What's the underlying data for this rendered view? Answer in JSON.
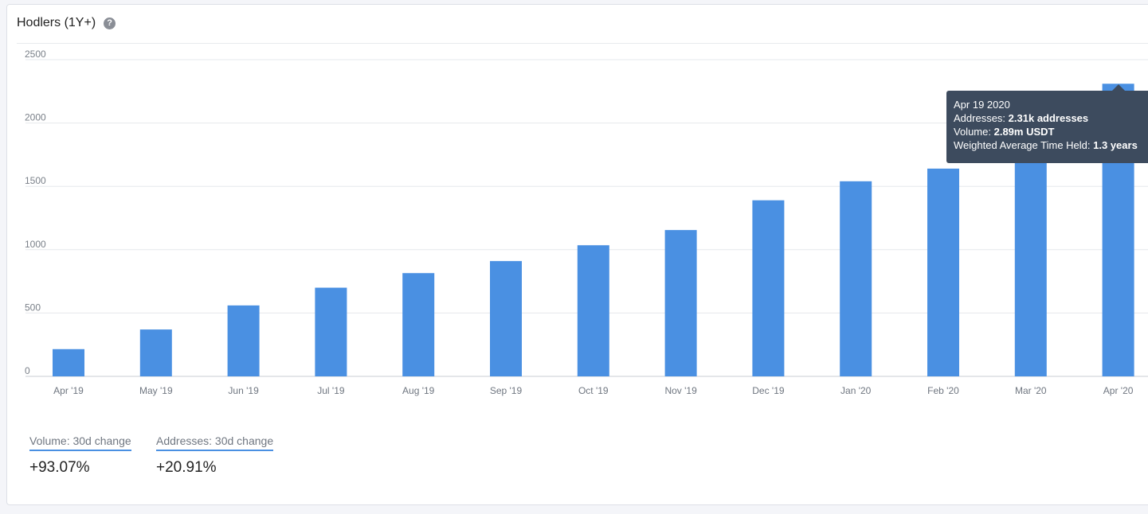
{
  "header": {
    "title": "Hodlers (1Y+)",
    "help_icon": "question-circle-icon"
  },
  "colors": {
    "bar": "#4a90e2",
    "grid": "#e6e8ec",
    "tooltip_bg": "#3d4b5e",
    "accent_underline": "#4a90e2"
  },
  "chart_data": {
    "type": "bar",
    "categories": [
      "Apr '19",
      "May '19",
      "Jun '19",
      "Jul '19",
      "Aug '19",
      "Sep '19",
      "Oct '19",
      "Nov '19",
      "Dec '19",
      "Jan '20",
      "Feb '20",
      "Mar '20",
      "Apr '20"
    ],
    "values": [
      215,
      370,
      560,
      700,
      815,
      910,
      1035,
      1155,
      1390,
      1540,
      1640,
      1970,
      2310
    ],
    "title": "",
    "xlabel": "",
    "ylabel": "",
    "ylim": [
      0,
      2500
    ],
    "yticks": [
      0,
      500,
      1000,
      1500,
      2000,
      2500
    ],
    "grid": true,
    "legend": "none"
  },
  "tooltip": {
    "date": "Apr 19 2020",
    "addresses_label": "Addresses:",
    "addresses_value": "2.31k addresses",
    "volume_label": "Volume:",
    "volume_value": "2.89m USDT",
    "wath_label": "Weighted Average Time Held:",
    "wath_value": "1.3 years"
  },
  "metrics": [
    {
      "label": "Volume: 30d change",
      "value": "+93.07%"
    },
    {
      "label": "Addresses: 30d change",
      "value": "+20.91%"
    }
  ]
}
